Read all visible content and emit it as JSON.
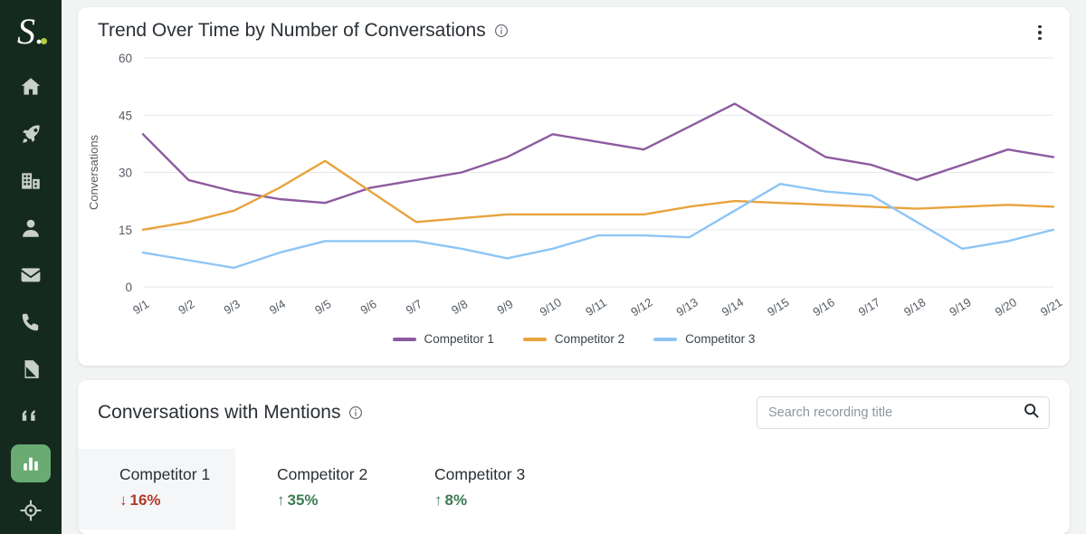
{
  "sidebar": {
    "logo": {
      "letter": "S.",
      "accent": "#b3cf3a"
    },
    "items": [
      {
        "name": "home-icon",
        "label": "Home"
      },
      {
        "name": "rocket-icon",
        "label": "Launch"
      },
      {
        "name": "building-icon",
        "label": "Accounts"
      },
      {
        "name": "person-icon",
        "label": "Contacts"
      },
      {
        "name": "mail-icon",
        "label": "Email"
      },
      {
        "name": "phone-icon",
        "label": "Calls"
      },
      {
        "name": "document-icon",
        "label": "Documents"
      },
      {
        "name": "quote-icon",
        "label": "Quotes"
      },
      {
        "name": "chart-icon",
        "label": "Analytics",
        "active": true
      },
      {
        "name": "target-icon",
        "label": "Goals"
      }
    ],
    "active_color": "#6aab74",
    "background": "#152a1e"
  },
  "chart_card": {
    "title": "Trend Over Time by Number of Conversations",
    "info_tooltip": "info",
    "menu": "more-options"
  },
  "chart_data": {
    "type": "line",
    "title": "Trend Over Time by Number of Conversations",
    "xlabel": "",
    "ylabel": "Conversations",
    "ylim": [
      0,
      60
    ],
    "yticks": [
      0,
      15,
      30,
      45,
      60
    ],
    "grid": true,
    "legend_position": "bottom",
    "categories": [
      "9/1",
      "9/2",
      "9/3",
      "9/4",
      "9/5",
      "9/6",
      "9/7",
      "9/8",
      "9/9",
      "9/10",
      "9/11",
      "9/12",
      "9/13",
      "9/14",
      "9/15",
      "9/16",
      "9/17",
      "9/18",
      "9/19",
      "9/20",
      "9/21"
    ],
    "series": [
      {
        "name": "Competitor 1",
        "color": "#8e5a9e",
        "values": [
          40,
          28,
          25,
          23,
          22,
          26,
          28,
          30,
          34,
          40,
          38,
          36,
          42,
          48,
          41,
          34,
          32,
          28,
          32,
          36,
          34
        ]
      },
      {
        "name": "Competitor 2",
        "color": "#e8a33d",
        "values": [
          15,
          17,
          20,
          26,
          33,
          25,
          17,
          18,
          19,
          19,
          19,
          19,
          21,
          22.5,
          22,
          21.5,
          21,
          20.5,
          21,
          21.5,
          21
        ]
      },
      {
        "name": "Competitor 3",
        "color": "#8ec5f5",
        "values": [
          9,
          7,
          5,
          9,
          12,
          12,
          12,
          10,
          7.5,
          10,
          13.5,
          13.5,
          13,
          20,
          27,
          25,
          24,
          17,
          10,
          12,
          15
        ]
      }
    ]
  },
  "table_card": {
    "title": "Conversations with Mentions",
    "info_tooltip": "info",
    "search": {
      "placeholder": "Search recording title",
      "value": "",
      "icon": "search-icon"
    },
    "competitor_tabs": [
      {
        "name": "Competitor 1",
        "delta": "16%",
        "arrow": "↓",
        "direction": "down",
        "selected": true
      },
      {
        "name": "Competitor 2",
        "delta": "35%",
        "arrow": "↑",
        "direction": "up",
        "selected": false
      },
      {
        "name": "Competitor 3",
        "delta": "8%",
        "arrow": "↑",
        "direction": "up",
        "selected": false
      }
    ]
  },
  "colors": {
    "page_background": "#f2f4f4",
    "card_background": "#ffffff",
    "down": "#b03a2a",
    "up": "#3c7b52"
  }
}
